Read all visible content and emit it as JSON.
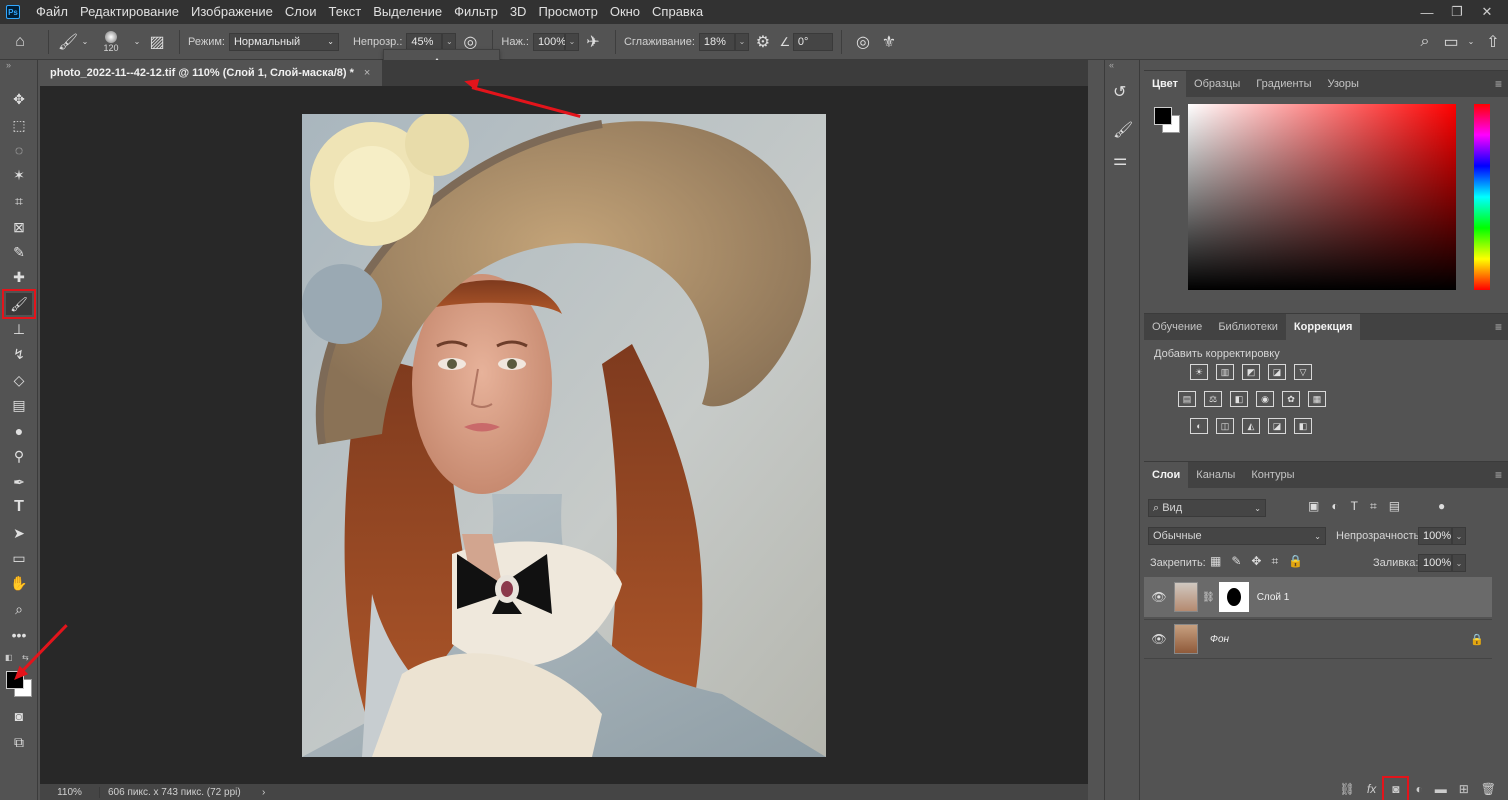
{
  "menu": [
    "Файл",
    "Редактирование",
    "Изображение",
    "Слои",
    "Текст",
    "Выделение",
    "Фильтр",
    "3D",
    "Просмотр",
    "Окно",
    "Справка"
  ],
  "options": {
    "brush_size": "120",
    "mode_label": "Режим:",
    "mode_value": "Нормальный",
    "opacity_label": "Непрозр.:",
    "opacity_value": "45%",
    "flow_label": "Наж.:",
    "flow_value": "100%",
    "smoothing_label": "Сглаживание:",
    "smoothing_value": "18%",
    "angle_value": "0°"
  },
  "slider": {
    "level": 0.45
  },
  "document": {
    "tab_title": "photo_2022-11--42-12.tif @ 110% (Слой 1, Слой-маска/8) *",
    "close": "×"
  },
  "status": {
    "zoom": "110%",
    "info": "606 пикс. x 743 пикс. (72 ppi)",
    "more": "›"
  },
  "color_panel": {
    "tabs": [
      "Цвет",
      "Образцы",
      "Градиенты",
      "Узоры"
    ],
    "active": 0
  },
  "adjust_panel": {
    "tabs": [
      "Обучение",
      "Библиотеки",
      "Коррекция"
    ],
    "active": 2,
    "hint": "Добавить корректировку",
    "icons_row1": [
      "☀",
      "▥",
      "◩",
      "◪",
      "▽"
    ],
    "icons_row2": [
      "▤",
      "⚖",
      "◧",
      "◉",
      "✿",
      "▦"
    ],
    "icons_row3": [
      "◐",
      "◫",
      "◭",
      "◪",
      "◧"
    ]
  },
  "layers_panel": {
    "tabs": [
      "Слои",
      "Каналы",
      "Контуры"
    ],
    "active": 0,
    "filter_label": "Вид",
    "blend_value": "Обычные",
    "opacity_label": "Непрозрачность:",
    "opacity_value": "100%",
    "lock_label": "Закрепить:",
    "fill_label": "Заливка:",
    "fill_value": "100%",
    "layers": [
      {
        "name": "Слой 1",
        "selected": true
      },
      {
        "name": "Фон",
        "selected": false
      }
    ]
  },
  "colors": {
    "accent_red": "#e3141b",
    "fg": "#000000",
    "bg": "#ffffff"
  }
}
